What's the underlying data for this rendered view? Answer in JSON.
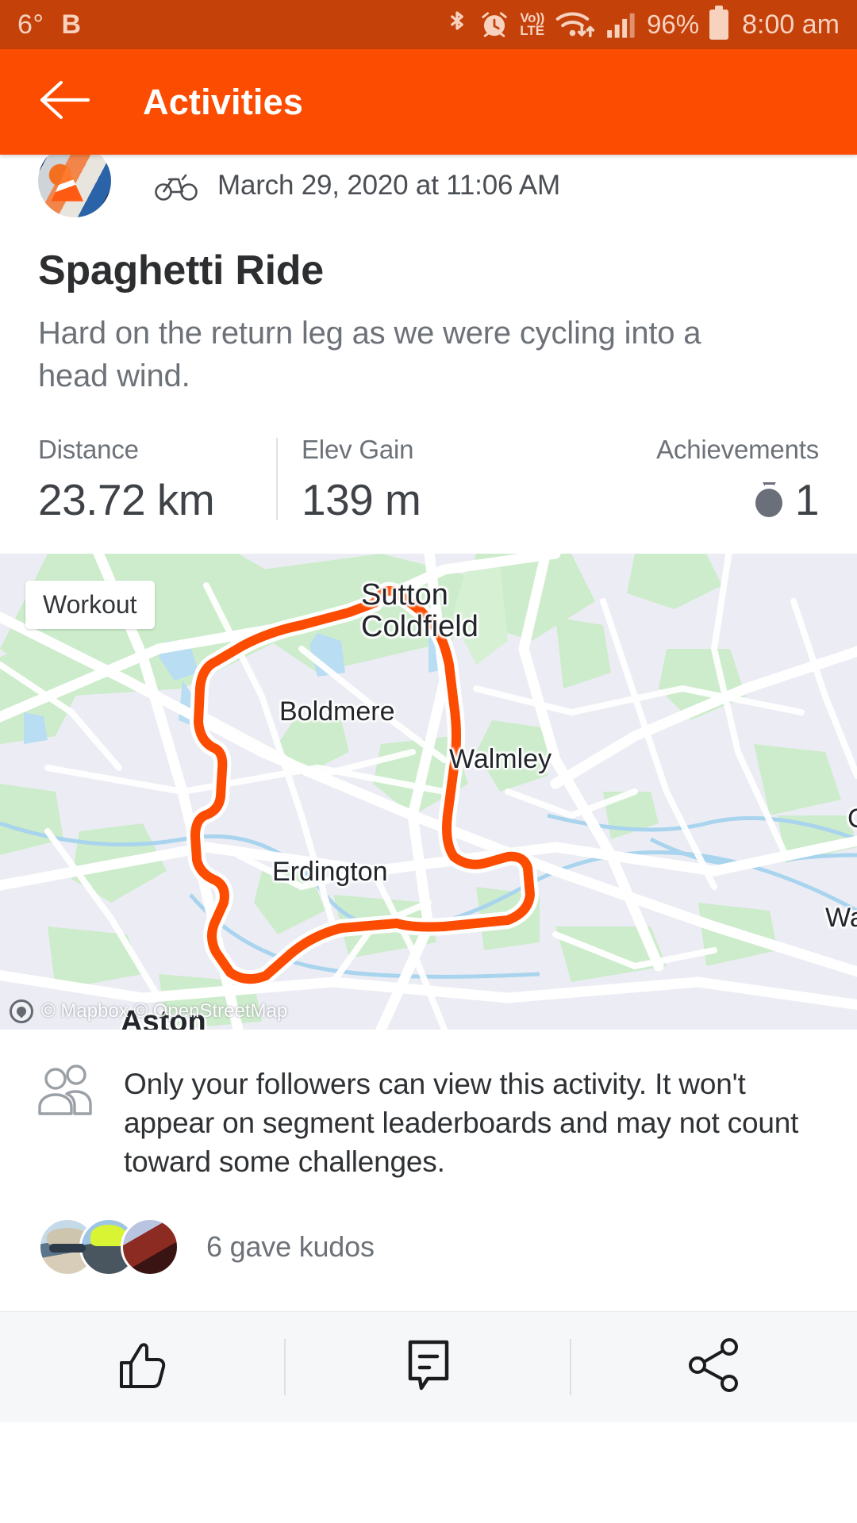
{
  "statusbar": {
    "temperature": "6°",
    "carrier": "B",
    "battery_percent": "96%",
    "time": "8:00 am",
    "volte_top": "Vo))",
    "volte_bottom": "LTE",
    "icons": [
      "bluetooth-icon",
      "alarm-icon",
      "volte-icon",
      "wifi-icon",
      "cellular-signal-icon",
      "battery-icon"
    ],
    "bg_color": "#c4410a",
    "fg_color": "#f6d2bf"
  },
  "appbar": {
    "title": "Activities",
    "back_icon": "back-arrow-icon",
    "bg_color": "#fc4c02"
  },
  "activity": {
    "sport_icon": "bicycle-icon",
    "date": "March 29, 2020 at 11:06 AM",
    "title": "Spaghetti Ride",
    "description": "Hard on the return leg as we were cycling into a head wind.",
    "stats": [
      {
        "label": "Distance",
        "value": "23.72 km"
      },
      {
        "label": "Elev Gain",
        "value": "139 m"
      },
      {
        "label": "Achievements",
        "value": "1",
        "icon": "medal-icon"
      }
    ]
  },
  "map": {
    "badge": "Workout",
    "route_color": "#fc4c02",
    "attribution": "© Mapbox © OpenStreetMap",
    "labels": [
      {
        "name": "Sutton Coldfield",
        "line1": "Sutton",
        "line2": "Coldfield"
      },
      {
        "name": "Boldmere"
      },
      {
        "name": "Walmley"
      },
      {
        "name": "Erdington"
      },
      {
        "name": "Aston"
      },
      {
        "name": "Wat"
      },
      {
        "name": "C"
      }
    ]
  },
  "privacy": {
    "icon": "followers-icon",
    "text": "Only your followers can view this activity. It won't appear on segment leaderboards and may not count toward some challenges."
  },
  "kudos": {
    "text": "6 gave kudos",
    "avatar_count": 3
  },
  "actions": [
    {
      "name": "kudos-button",
      "icon": "thumbs-up-icon"
    },
    {
      "name": "comment-button",
      "icon": "comment-icon"
    },
    {
      "name": "share-button",
      "icon": "share-icon"
    }
  ]
}
